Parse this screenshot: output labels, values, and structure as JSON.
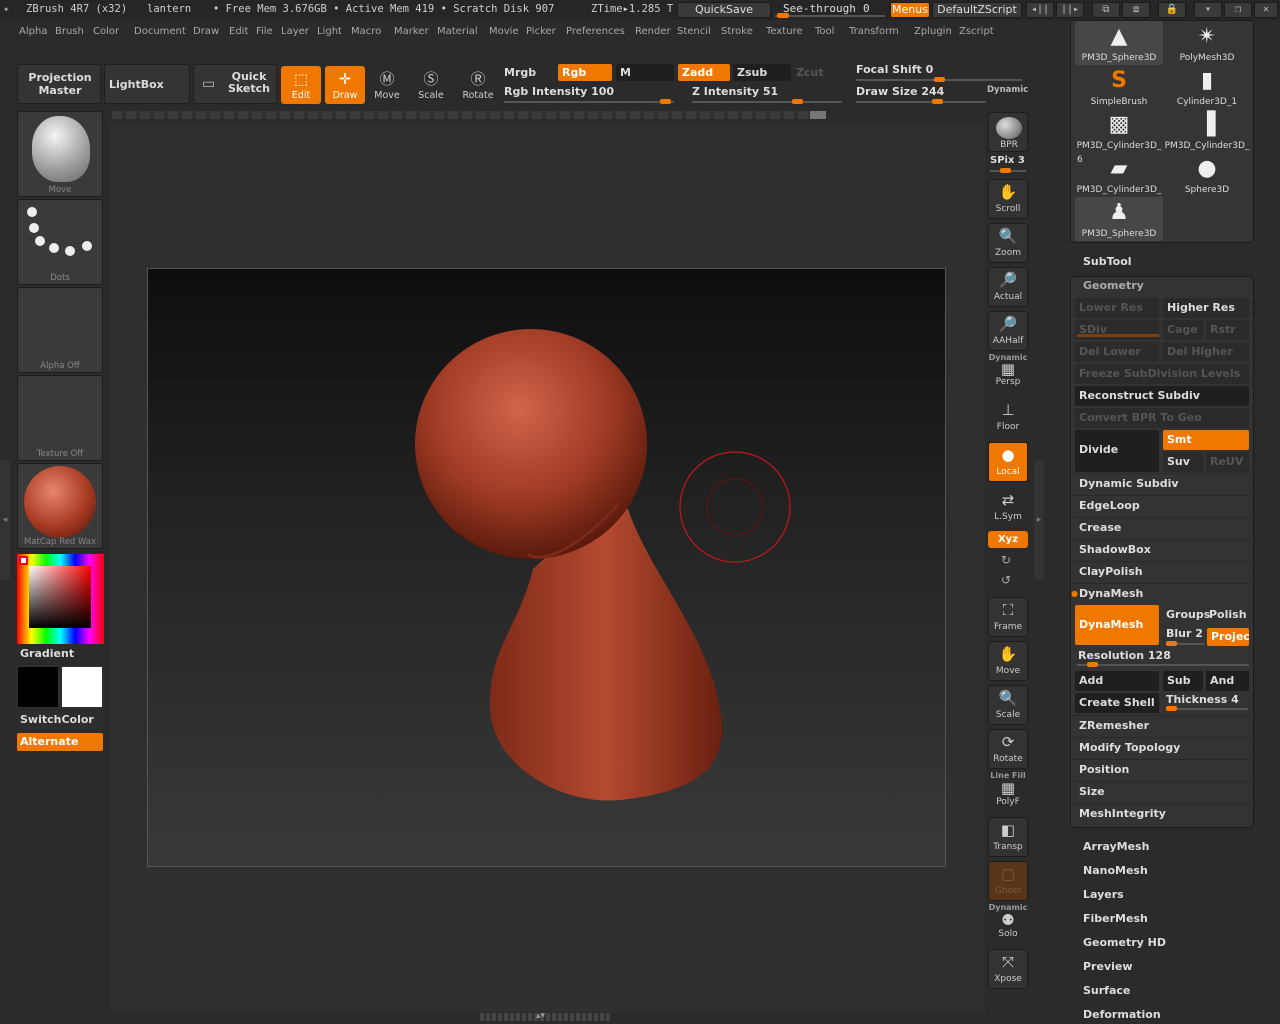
{
  "titlebar": {
    "app": "ZBrush 4R7 (x32)",
    "doc": "lantern",
    "free_mem": "• Free Mem 3.676GB • Active Mem 419 • Scratch Disk 907",
    "ztime": "ZTime▸1.285 T",
    "quicksave": "QuickSave",
    "seethrough": "See-through",
    "seethrough_val": "0",
    "menus": "Menus",
    "script": "DefaultZScript"
  },
  "menubar": [
    "Alpha",
    "Brush",
    "Color",
    "Document",
    "Draw",
    "Edit",
    "File",
    "Layer",
    "Light",
    "Macro",
    "Marker",
    "Material",
    "Movie",
    "Picker",
    "Preferences",
    "Render",
    "Stencil",
    "Stroke",
    "Texture",
    "Tool",
    "Transform",
    "Zplugin",
    "Zscript"
  ],
  "top_shelf": {
    "projection_master": "Projection Master",
    "lightbox": "LightBox",
    "quick_sketch": "Quick Sketch",
    "edit": "Edit",
    "draw": "Draw",
    "move": "Move",
    "scale": "Scale",
    "rotate": "Rotate",
    "mrgb": "Mrgb",
    "rgb": "Rgb",
    "m": "M",
    "zadd": "Zadd",
    "zsub": "Zsub",
    "zcut": "Zcut",
    "rgb_intensity": "Rgb Intensity 100",
    "z_intensity": "Z Intensity 51",
    "focal_shift": "Focal Shift 0",
    "draw_size": "Draw Size 244",
    "dynamic": "Dynamic"
  },
  "left_panel": {
    "brush": "Move",
    "stroke": "Dots",
    "alpha": "Alpha Off",
    "texture": "Texture Off",
    "material": "MatCap Red Wax",
    "gradient": "Gradient",
    "switchcolor": "SwitchColor",
    "alternate": "Alternate"
  },
  "right_shelf": {
    "bpr": "BPR",
    "spix": "SPix 3",
    "scroll": "Scroll",
    "zoom": "Zoom",
    "actual": "Actual",
    "aahalf": "AAHalf",
    "dynamic": "Dynamic",
    "persp": "Persp",
    "floor": "Floor",
    "local": "Local",
    "lsym": "L.Sym",
    "xyz": "Xyz",
    "frame": "Frame",
    "move": "Move",
    "scale": "Scale",
    "rotate": "Rotate",
    "line_fill": "Line Fill",
    "polyf": "PolyF",
    "transp": "Transp",
    "ghost": "Ghost",
    "dynamic2": "Dynamic",
    "solo": "Solo",
    "xpose": "Xpose"
  },
  "subtools": [
    {
      "label": "PM3D_Sphere3D",
      "icon": "▲"
    },
    {
      "label": "PolyMesh3D",
      "icon": "✴"
    },
    {
      "label": "SimpleBrush",
      "icon": "S"
    },
    {
      "label": "Cylinder3D_1",
      "icon": "▮"
    },
    {
      "label": "PM3D_Cylinder3D_",
      "icon": "▩"
    },
    {
      "label": "PM3D_Cylinder3D_",
      "icon": "▐"
    },
    {
      "label": "PM3D_Cylinder3D_",
      "icon": "▰"
    },
    {
      "label": "Sphere3D",
      "icon": "●"
    },
    {
      "label": "PM3D_Sphere3D",
      "icon": "♟"
    }
  ],
  "subtool_extra_num": "6",
  "geometry": {
    "subtool": "SubTool",
    "geometry": "Geometry",
    "lower_res": "Lower Res",
    "higher_res": "Higher Res",
    "sdiv": "SDiv",
    "cage": "Cage",
    "rstr": "Rstr",
    "del_lower": "Del Lower",
    "del_higher": "Del Higher",
    "freeze": "Freeze SubDivision Levels",
    "reconstruct": "Reconstruct Subdiv",
    "convert_bpr": "Convert BPR To Geo",
    "divide": "Divide",
    "smt": "Smt",
    "suv": "Suv",
    "reuv": "ReUV",
    "dynamic_subdiv": "Dynamic Subdiv",
    "edgeloop": "EdgeLoop",
    "crease": "Crease",
    "shadowbox": "ShadowBox",
    "claypolish": "ClayPolish",
    "dynamesh_header": "DynaMesh",
    "dynamesh": "DynaMesh",
    "groups": "Groups",
    "polish": "Polish",
    "blur": "Blur 2",
    "project": "Projec",
    "resolution": "Resolution 128",
    "add": "Add",
    "sub": "Sub",
    "and": "And",
    "create_shell": "Create Shell",
    "thickness": "Thickness 4",
    "zremesher": "ZRemesher",
    "modify_topology": "Modify Topology",
    "position": "Position",
    "size": "Size",
    "meshintegrity": "MeshIntegrity"
  },
  "sections": [
    "ArrayMesh",
    "NanoMesh",
    "Layers",
    "FiberMesh",
    "Geometry HD",
    "Preview",
    "Surface",
    "Deformation"
  ]
}
